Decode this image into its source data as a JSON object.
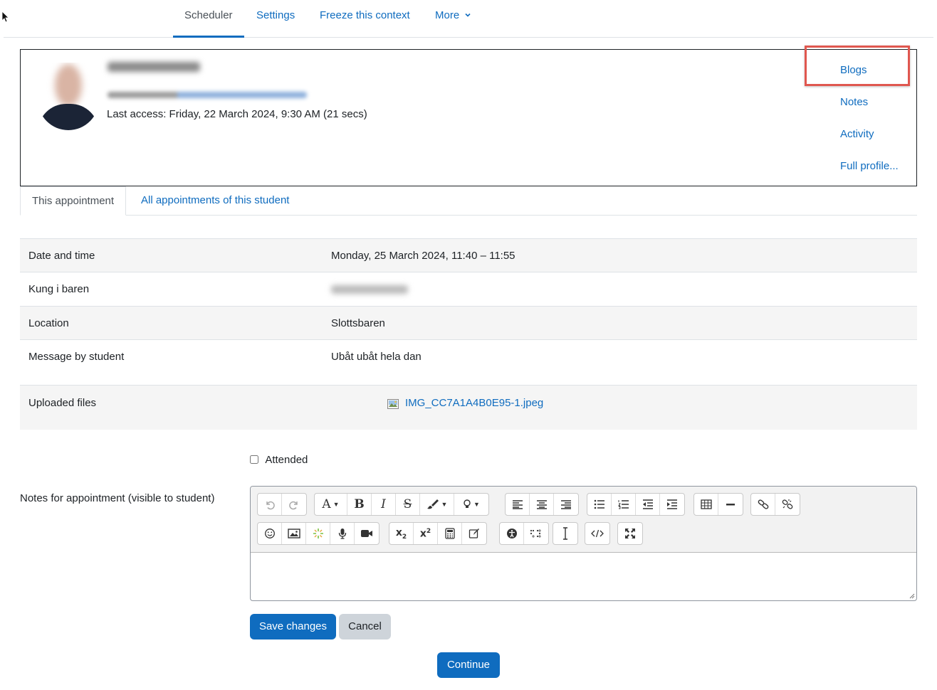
{
  "nav": {
    "tabs": [
      {
        "label": "Scheduler"
      },
      {
        "label": "Settings"
      },
      {
        "label": "Freeze this context"
      },
      {
        "label": "More"
      }
    ]
  },
  "user": {
    "last_access": "Last access: Friday, 22 March 2024, 9:30 AM  (21 secs)",
    "links": {
      "blogs": "Blogs",
      "notes": "Notes",
      "activity": "Activity",
      "full_profile": "Full profile..."
    }
  },
  "appointment_tabs": {
    "this": "This appointment",
    "all": "All appointments of this student"
  },
  "details": {
    "date_label": "Date and time",
    "date_value": "Monday, 25 March 2024, 11:40 – 11:55",
    "teacher_label": "Kung i baren",
    "location_label": "Location",
    "location_value": "Slottsbaren",
    "message_label": "Message by student",
    "message_value": "Ubåt ubåt hela dan",
    "files_label": "Uploaded files",
    "file_name": "IMG_CC7A1A4B0E95-1.jpeg"
  },
  "form": {
    "attended_label": "Attended",
    "attended_checked": false,
    "notes_label": "Notes for appointment (visible to student)",
    "notes_value": "",
    "save": "Save changes",
    "cancel": "Cancel",
    "continue": "Continue"
  },
  "colors": {
    "link": "#0f6cbf",
    "primary_button": "#0f6cbf",
    "secondary_button": "#ced4da",
    "highlight": "#e0574f"
  }
}
